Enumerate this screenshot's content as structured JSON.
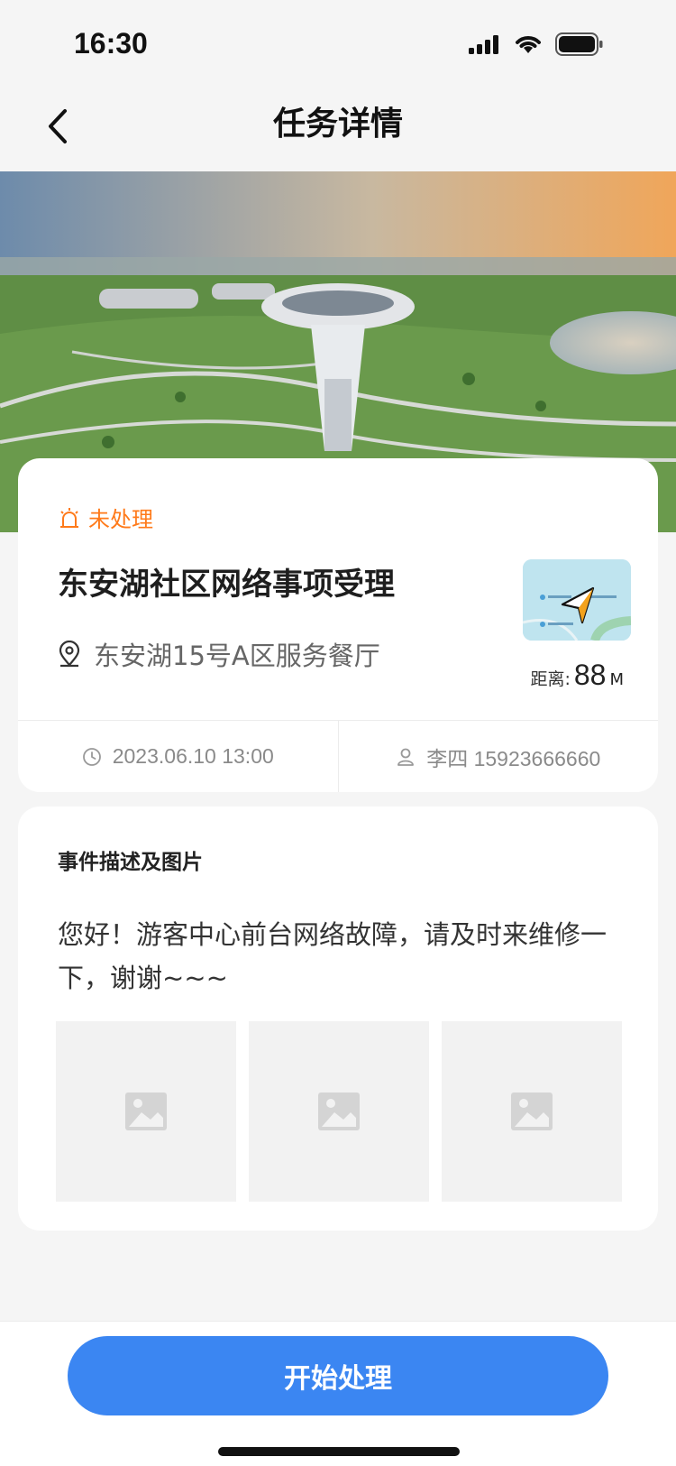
{
  "status_bar": {
    "time": "16:30"
  },
  "nav": {
    "title": "任务详情"
  },
  "task": {
    "status": "未处理",
    "status_color": "#ff7a1a",
    "title": "东安湖社区网络事项受理",
    "address": "东安湖15号A区服务餐厅",
    "distance_label": "距离:",
    "distance_value": "88",
    "distance_unit": "M",
    "datetime": "2023.06.10 13:00",
    "contact": "李四 15923666660"
  },
  "description": {
    "title": "事件描述及图片",
    "text": "您好！游客中心前台网络故障，请及时来维修一下，谢谢~~~",
    "images": [
      "image-placeholder",
      "image-placeholder",
      "image-placeholder"
    ]
  },
  "actions": {
    "primary": "开始处理"
  },
  "colors": {
    "primary": "#3b86f2",
    "background": "#f5f5f5"
  }
}
